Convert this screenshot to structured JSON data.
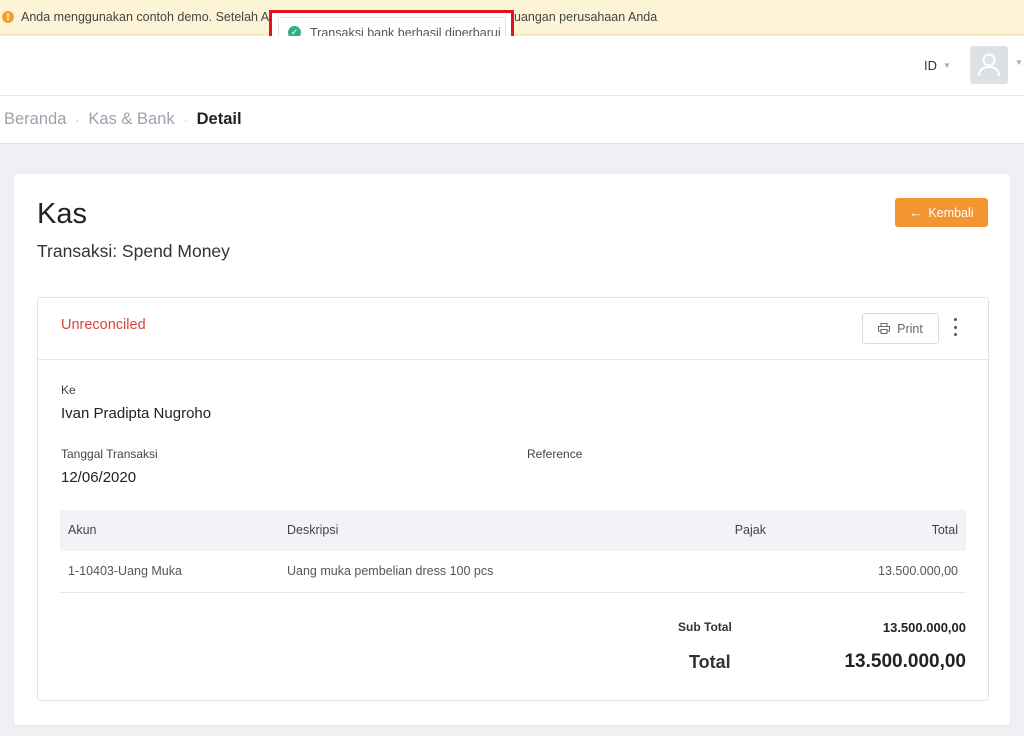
{
  "demo_banner": {
    "text_left": "Anda menggunakan contoh demo. Setelah An",
    "text_right": "uangan perusahaan Anda"
  },
  "toast": {
    "message": "Transaksi bank berhasil diperbarui",
    "highlight_color": "#e0141e"
  },
  "header": {
    "language": "ID"
  },
  "breadcrumb": [
    "Beranda",
    "Kas & Bank",
    "Detail"
  ],
  "page": {
    "title": "Kas",
    "subtitle": "Transaksi: Spend Money",
    "back_label": "Kembali"
  },
  "detail": {
    "status": "Unreconciled",
    "status_color": "#d9443f",
    "print_label": "Print",
    "to_label": "Ke",
    "to_value": "Ivan Pradipta Nugroho",
    "date_label": "Tanggal Transaksi",
    "date_value": "12/06/2020",
    "reference_label": "Reference",
    "reference_value": ""
  },
  "table": {
    "columns": [
      "Akun",
      "Deskripsi",
      "Pajak",
      "Total"
    ],
    "rows": [
      {
        "account": "1-10403-Uang Muka",
        "description": "Uang muka pembelian dress 100 pcs",
        "tax": "",
        "total": "13.500.000,00"
      }
    ]
  },
  "summary": {
    "subtotal_label": "Sub Total",
    "subtotal_value": "13.500.000,00",
    "total_label": "Total",
    "total_value": "13.500.000,00"
  },
  "colors": {
    "accent": "#f39530",
    "success": "#35b07d",
    "warning": "#f0a030"
  },
  "icons": [
    "warning-icon",
    "check-circle-icon",
    "user-icon",
    "arrow-left-icon",
    "printer-icon",
    "more-vertical-icon"
  ]
}
